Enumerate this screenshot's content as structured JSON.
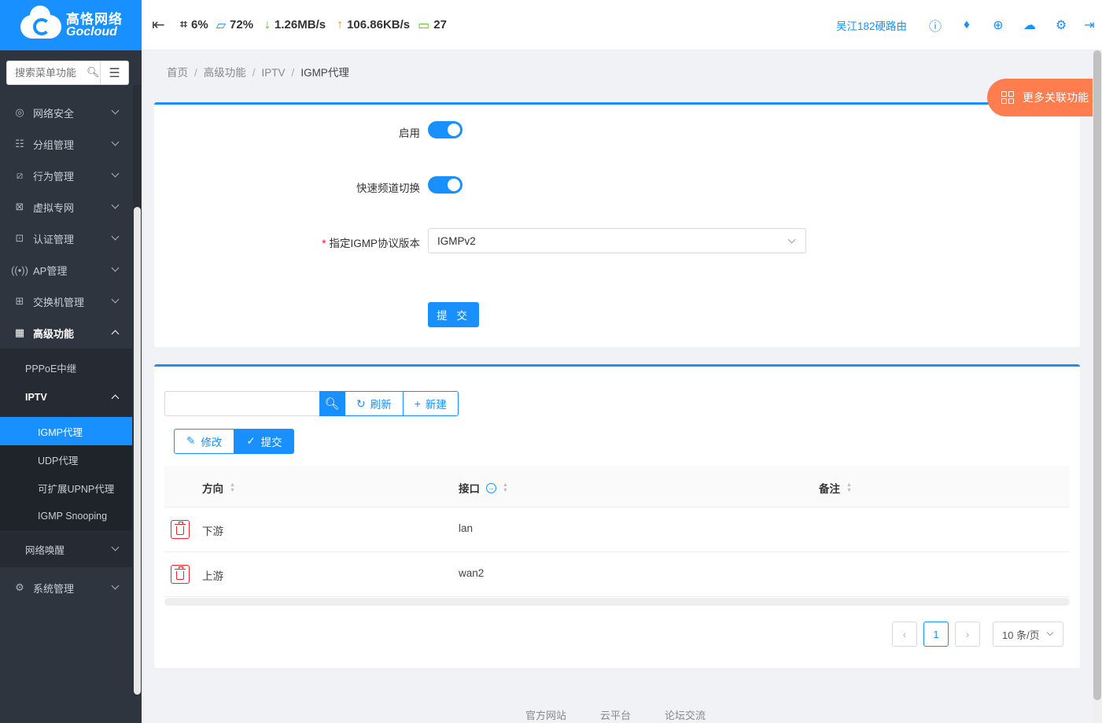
{
  "brand": {
    "cn": "高恪网络",
    "en": "Gocloud"
  },
  "sidebar": {
    "search_placeholder": "搜索菜单功能",
    "items": [
      {
        "label": "网络安全",
        "icon": "globe-shield-icon"
      },
      {
        "label": "分组管理",
        "icon": "list-icon"
      },
      {
        "label": "行为管理",
        "icon": "chart-icon"
      },
      {
        "label": "虚拟专网",
        "icon": "vpn-icon"
      },
      {
        "label": "认证管理",
        "icon": "user-card-icon"
      },
      {
        "label": "AP管理",
        "icon": "wifi-signal-icon"
      },
      {
        "label": "交换机管理",
        "icon": "switch-icon"
      }
    ],
    "advanced": {
      "label": "高级功能"
    },
    "advanced_sub": {
      "pppoe": "PPPoE中继",
      "iptv": "IPTV",
      "iptv_children": [
        "IGMP代理",
        "UDP代理",
        "可扩展UPNP代理",
        "IGMP Snooping"
      ],
      "wakeup": "网络唤醒"
    },
    "system": {
      "label": "系统管理"
    }
  },
  "header": {
    "cpu": "6%",
    "mem": "72%",
    "down": "1.26MB/s",
    "up": "106.86KB/s",
    "clients": "27",
    "device_name": "吴江182硬路由"
  },
  "breadcrumb": [
    "首页",
    "高级功能",
    "IPTV",
    "IGMP代理"
  ],
  "more_button": "更多关联功能",
  "form": {
    "enable_label": "启用",
    "enable_on": true,
    "fast_switch_label": "快速频道切换",
    "fast_switch_on": true,
    "version_label": "指定IGMP协议版本",
    "version_value": "IGMPv2",
    "submit": "提 交"
  },
  "toolbar": {
    "refresh": "刷新",
    "new": "新建",
    "edit": "修改",
    "submit": "提交"
  },
  "table": {
    "columns": [
      "方向",
      "接口",
      "备注"
    ],
    "rows": [
      {
        "direction": "下游",
        "interface": "lan",
        "remark": ""
      },
      {
        "direction": "上游",
        "interface": "wan2",
        "remark": ""
      }
    ]
  },
  "pagination": {
    "current": "1",
    "page_size": "10 条/页"
  },
  "footer": [
    "官方网站",
    "云平台",
    "论坛交流"
  ]
}
